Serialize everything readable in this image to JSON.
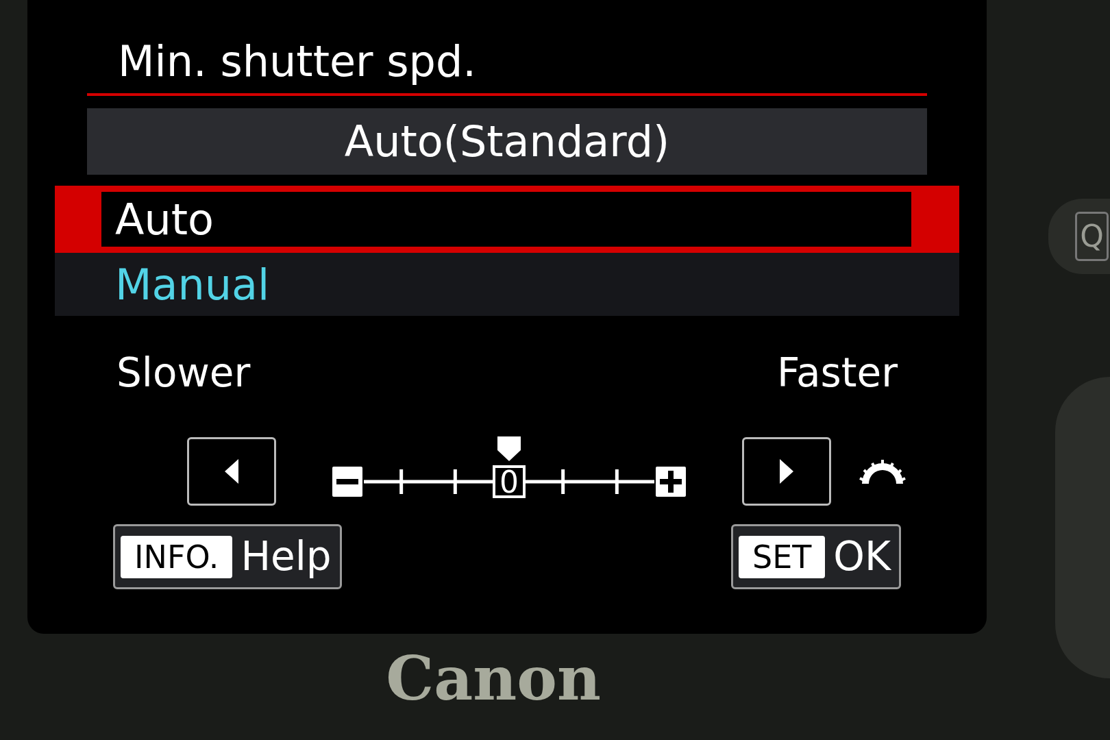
{
  "title": "Min. shutter spd.",
  "current_value": "Auto(Standard)",
  "options": [
    {
      "label": "Auto",
      "selected": true
    },
    {
      "label": "Manual",
      "selected": false
    }
  ],
  "scale": {
    "left_label": "Slower",
    "right_label": "Faster",
    "zero": "0",
    "level": 0.5
  },
  "help_button": {
    "key": "INFO.",
    "label": "Help"
  },
  "ok_button": {
    "key": "SET",
    "label": "OK"
  },
  "q_button": "Q",
  "brand": "Canon"
}
